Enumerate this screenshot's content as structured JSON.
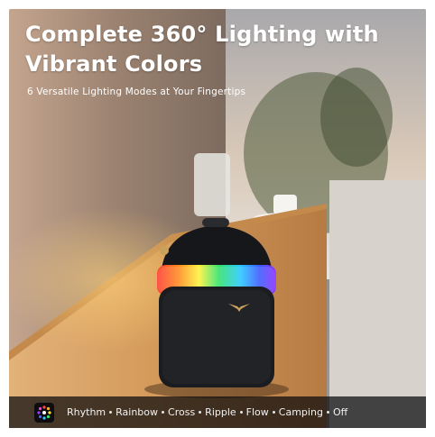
{
  "heading": {
    "line1": "Complete 360° Lighting with",
    "line2": "Vibrant Colors"
  },
  "subheading": "6 Versatile Lighting Modes at Your Fingertips",
  "modes": [
    "Rhythm",
    "Rainbow",
    "Cross",
    "Ripple",
    "Flow",
    "Camping",
    "Off"
  ],
  "icons": {
    "mode_icon": "light-burst-icon",
    "brand_logo": "bird-logo-icon"
  },
  "colors": {
    "headline": "#ffffff",
    "logo_gold": "#c9a15a",
    "bar_background": "#0a0a0c"
  }
}
